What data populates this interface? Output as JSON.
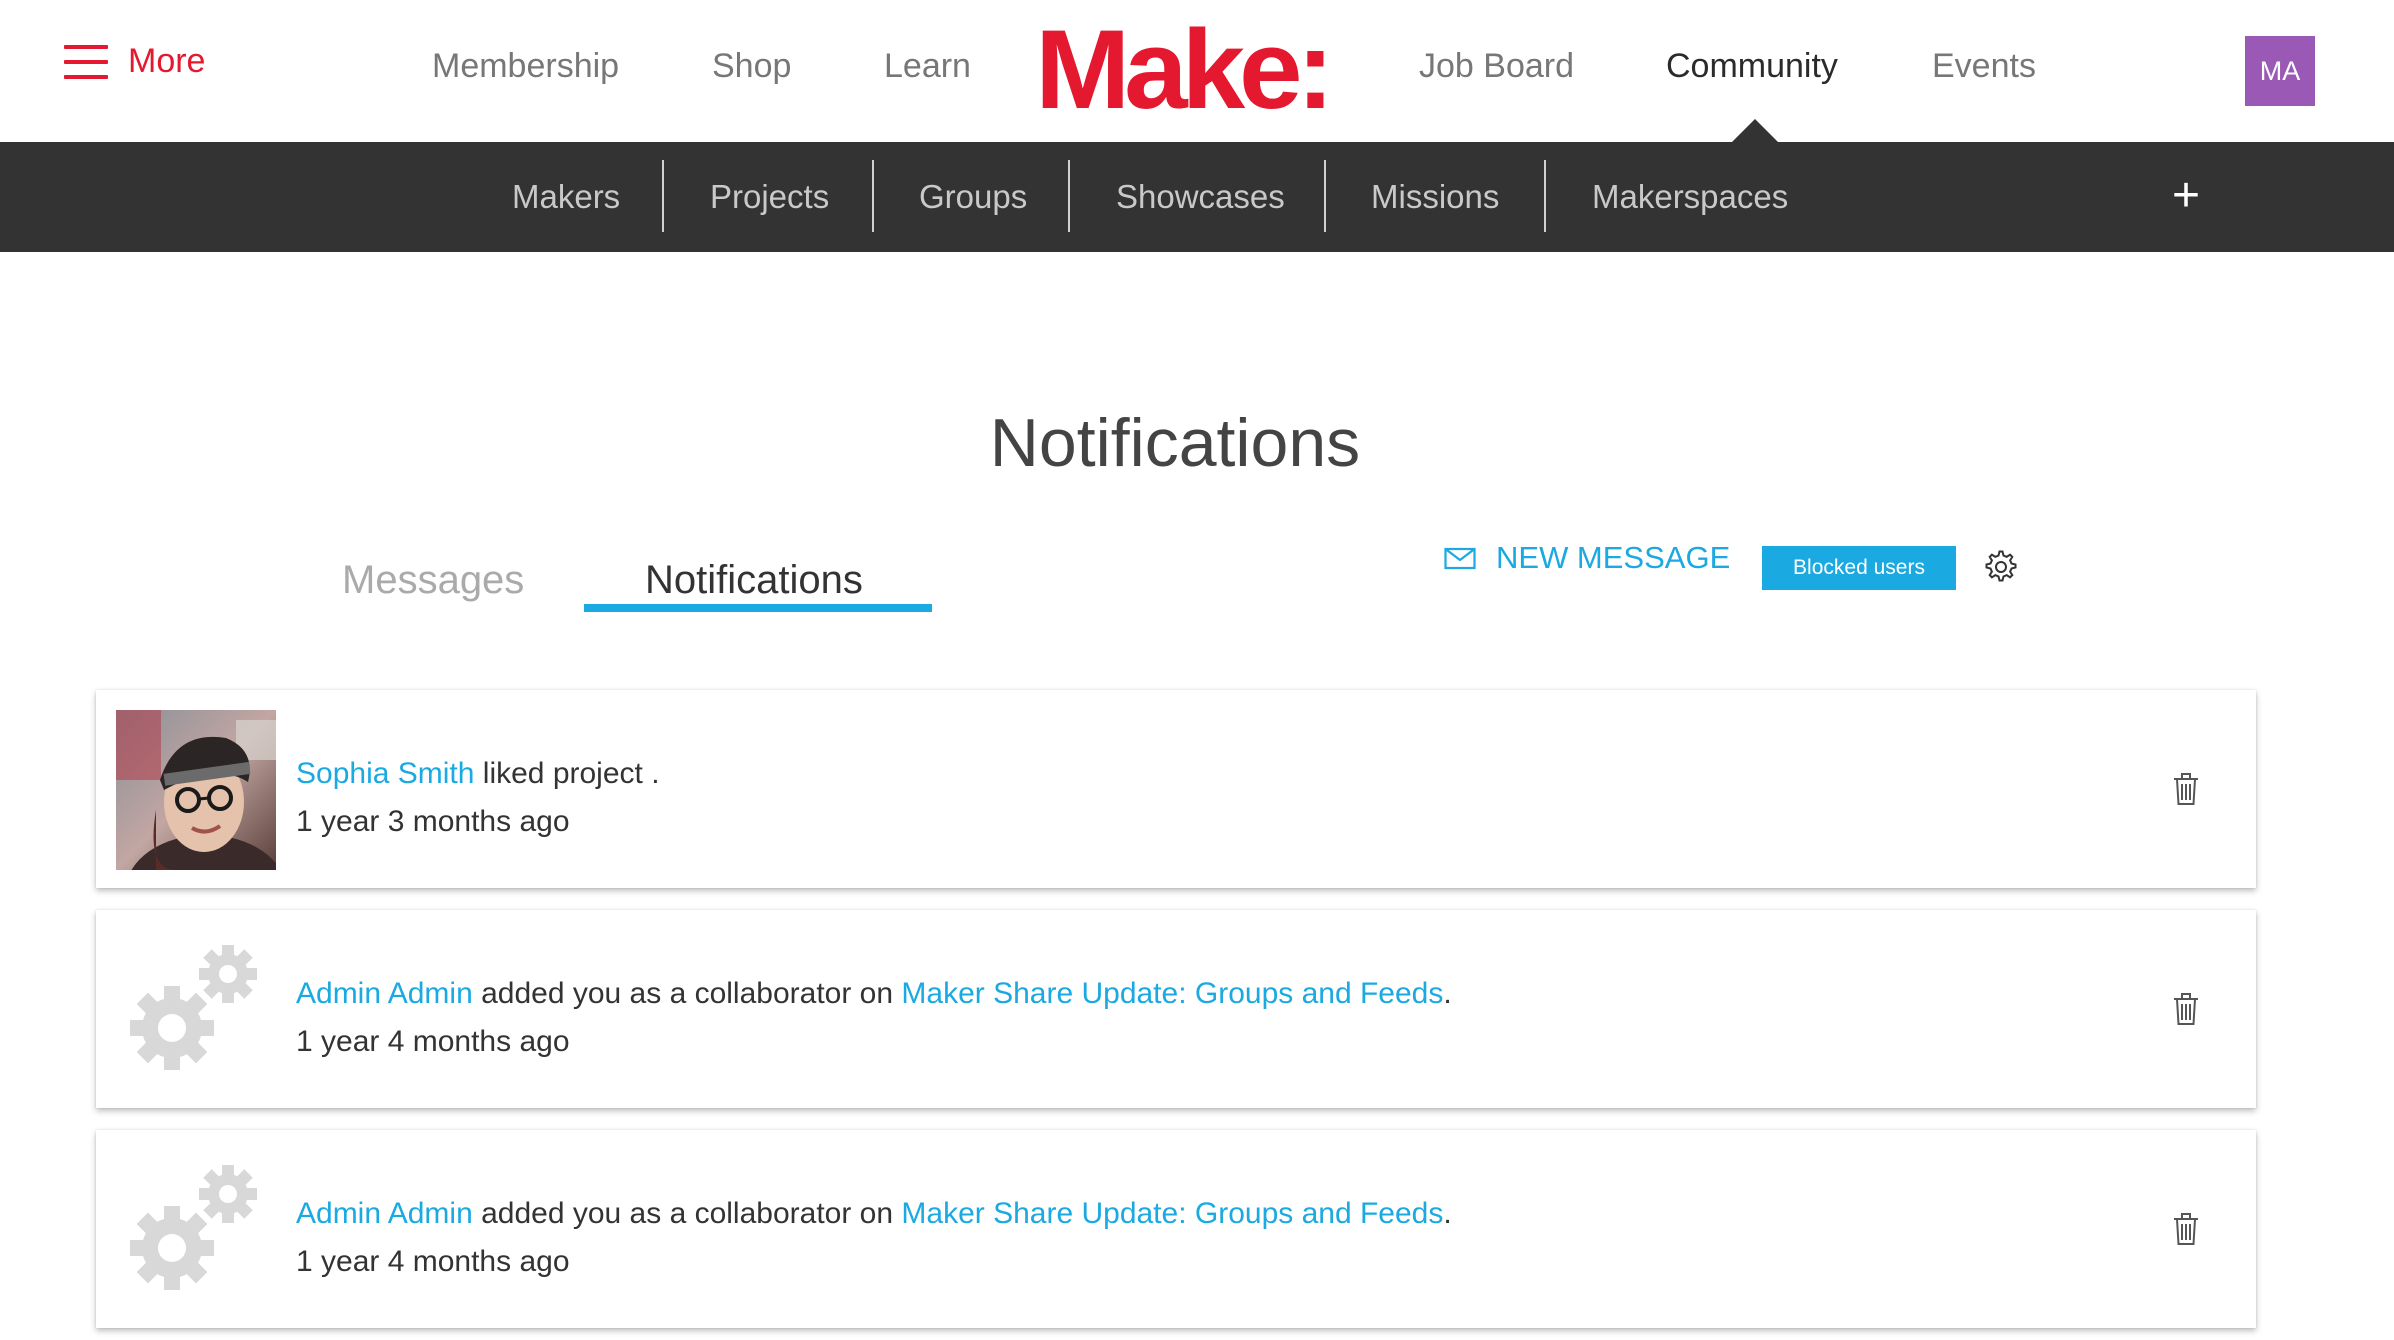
{
  "header": {
    "menu_label": "More",
    "nav": [
      "Membership",
      "Shop",
      "Learn",
      "Job Board",
      "Community",
      "Events"
    ],
    "logo": "Make:",
    "avatar_initials": "MA",
    "accent_color": "#e4192f",
    "avatar_color": "#9b59b6"
  },
  "subnav": {
    "items": [
      "Makers",
      "Projects",
      "Groups",
      "Showcases",
      "Missions",
      "Makerspaces"
    ],
    "add_label": "+"
  },
  "page": {
    "title": "Notifications",
    "tabs": [
      "Messages",
      "Notifications"
    ],
    "active_tab": "Notifications",
    "new_message_label": "NEW MESSAGE",
    "blocked_users_label": "Blocked users",
    "link_color": "#1ba9e1"
  },
  "notifications": [
    {
      "actor": "Sophia Smith",
      "action": "liked project .",
      "target": "",
      "suffix": "",
      "time": "1 year 3 months ago",
      "avatar": "user-photo"
    },
    {
      "actor": "Admin Admin",
      "action": " added you as a collaborator on",
      "target": "Maker Share Update: Groups and Feeds",
      "suffix": ".",
      "time": "1 year 4 months ago",
      "avatar": "gears-icon"
    },
    {
      "actor": "Admin Admin",
      "action": " added you as a collaborator on",
      "target": "Maker Share Update: Groups and Feeds",
      "suffix": ".",
      "time": "1 year 4 months ago",
      "avatar": "gears-icon"
    }
  ]
}
